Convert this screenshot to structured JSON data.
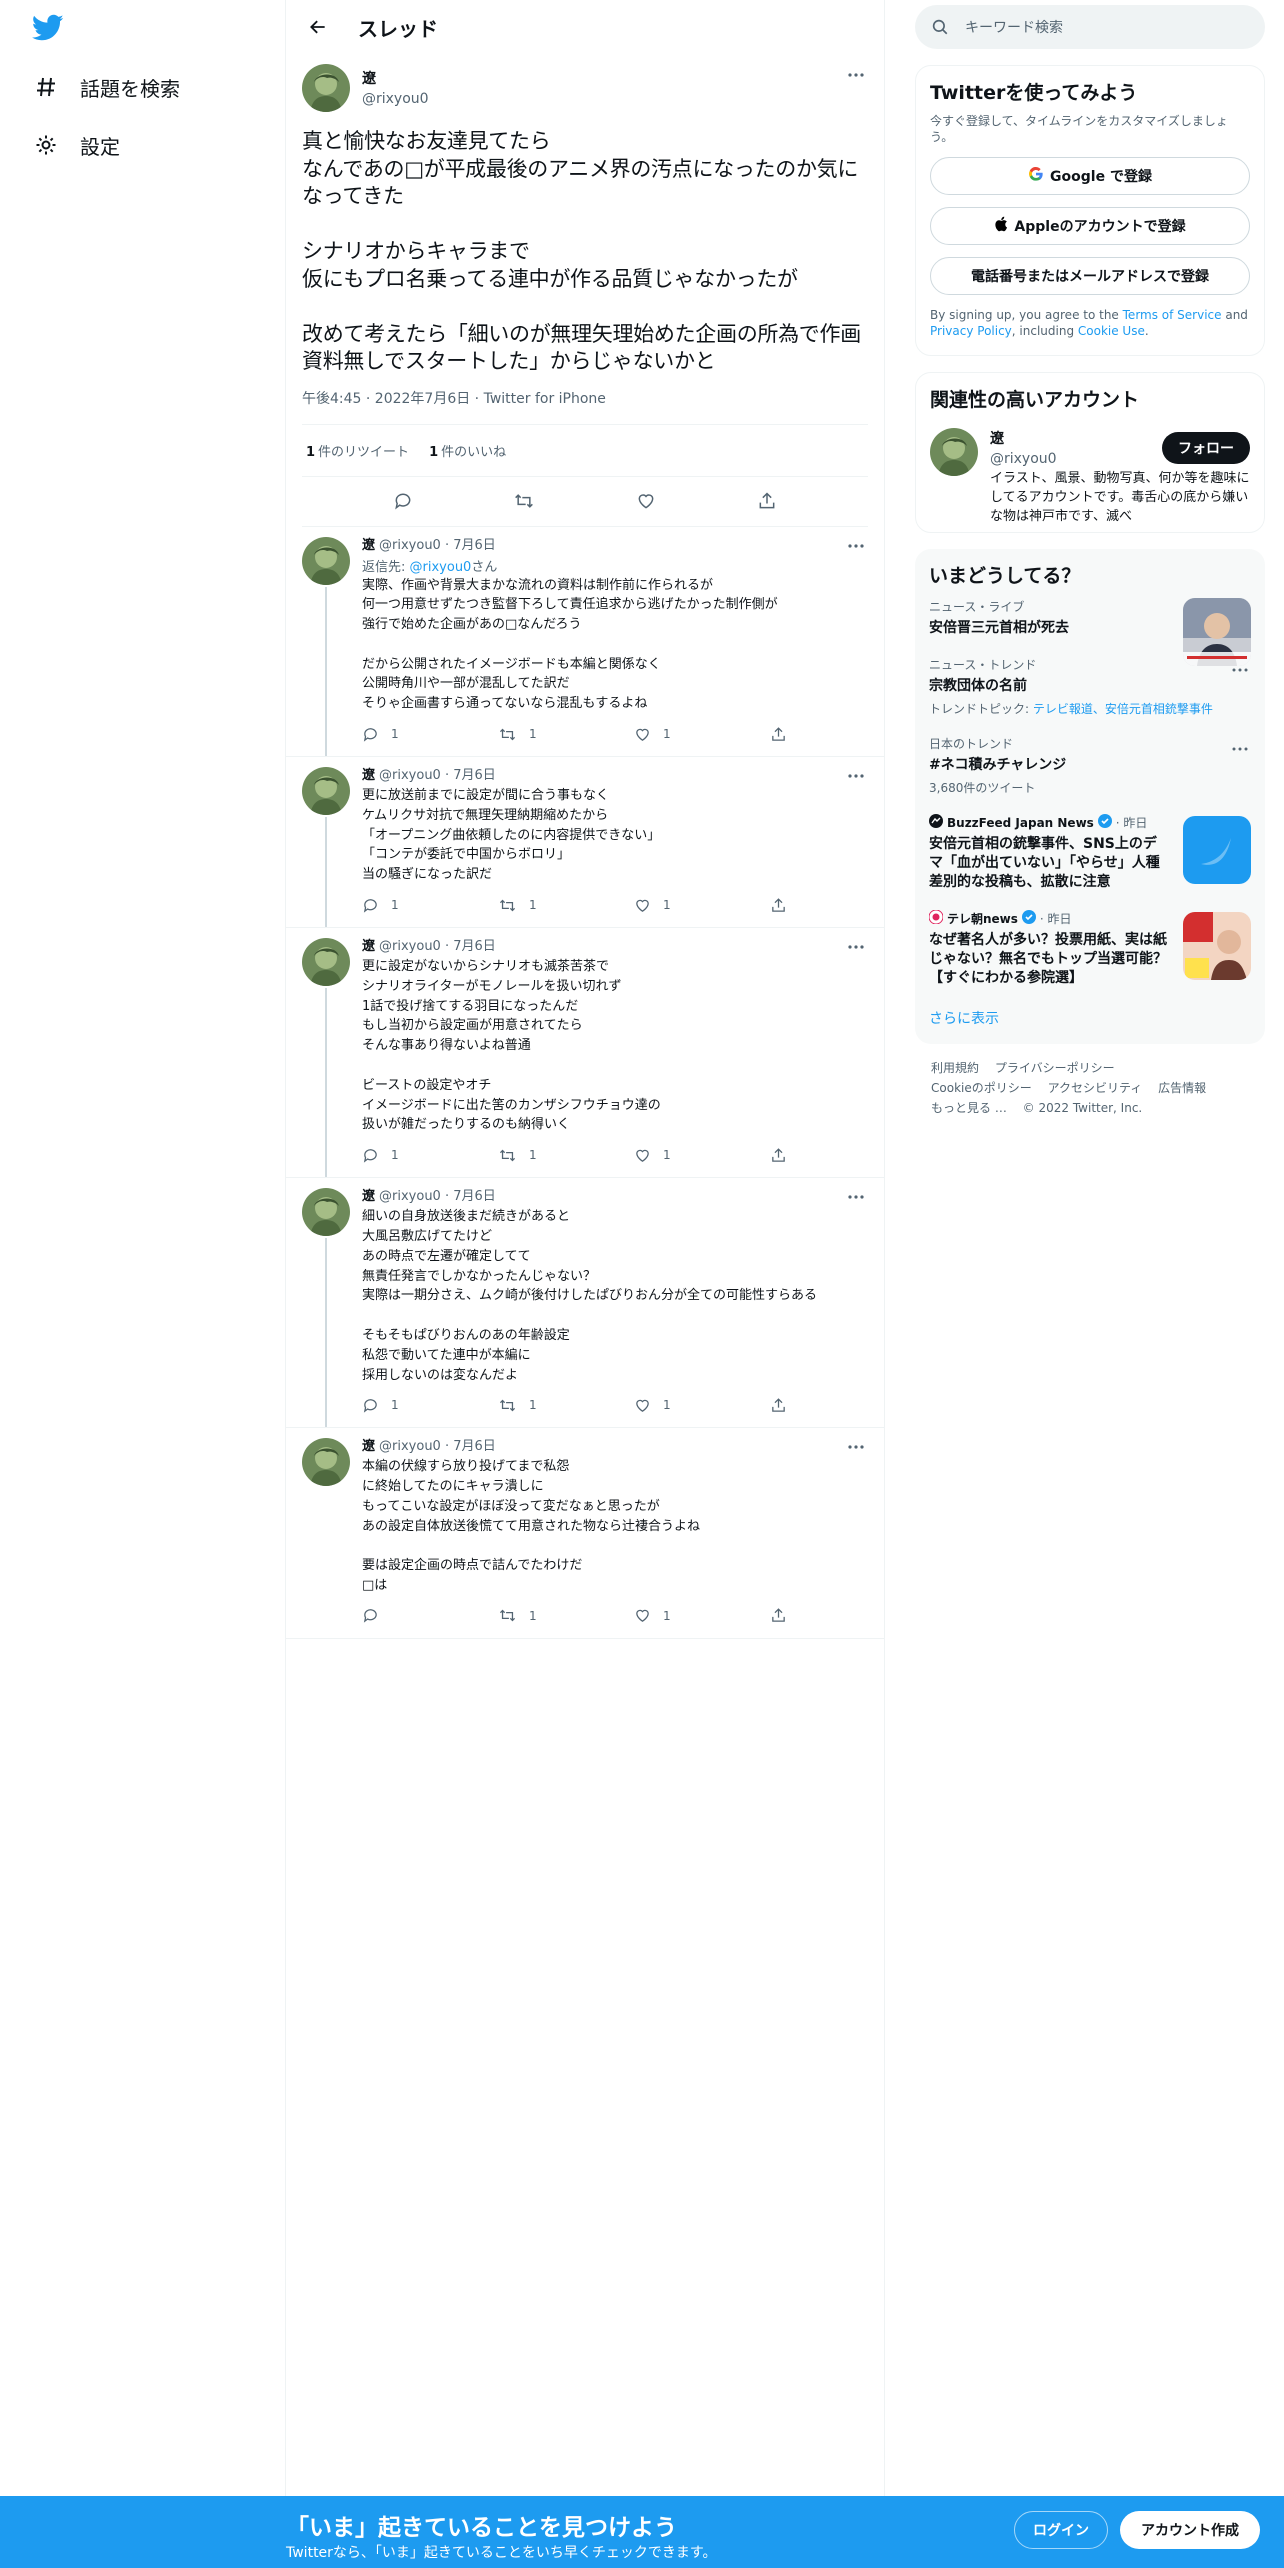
{
  "colors": {
    "accent": "#1d9bf0",
    "text": "#0f1419",
    "muted": "#536471"
  },
  "nav": {
    "logo": "twitter-bird-icon",
    "items": [
      {
        "label": "話題を検索",
        "icon": "hashtag-icon"
      },
      {
        "label": "設定",
        "icon": "gear-icon"
      }
    ]
  },
  "header": {
    "title": "スレッド"
  },
  "focal": {
    "name": "遼",
    "handle": "@rixyou0",
    "text": "真と愉快なお友達見てたら\nなんであの□が平成最後のアニメ界の汚点になったのか気になってきた\n\nシナリオからキャラまで\n仮にもプロ名乗ってる連中が作る品質じゃなかったが\n\n改めて考えたら「細いのが無理矢理始めた企画の所為で作画資料無しでスタートした」からじゃないかと",
    "meta": "午後4:45 · 2022年7月6日 · Twitter for iPhone",
    "retweets_count": "1",
    "retweets_label": "件のリツイート",
    "likes_count": "1",
    "likes_label": "件のいいね"
  },
  "replies": [
    {
      "name": "遼",
      "meta": "@rixyou0 · 7月6日",
      "replying_to_prefix": "返信先: ",
      "replying_to_handle": "@rixyou0",
      "replying_to_suffix": "さん",
      "text": "実際、作画や背景大まかな流れの資料は制作前に作られるが\n何一つ用意せずたつき監督下ろして責任追求から逃げたかった制作側が\n強行で始めた企画があの□なんだろう\n\nだから公開されたイメージボードも本編と関係なく\n公開時角川や一部が混乱してた訳だ\nそりゃ企画書すら通ってないなら混乱もするよね",
      "replies": "1",
      "retweets": "1",
      "likes": "1"
    },
    {
      "name": "遼",
      "meta": "@rixyou0 · 7月6日",
      "text": "更に放送前までに設定が間に合う事もなく\nケムリクサ対抗で無理矢理納期縮めたから\n「オープニング曲依頼したのに内容提供できない」\n「コンテが委託で中国からボロリ」\n当の騒ぎになった訳だ",
      "replies": "1",
      "retweets": "1",
      "likes": "1"
    },
    {
      "name": "遼",
      "meta": "@rixyou0 · 7月6日",
      "text": "更に設定がないからシナリオも滅茶苦茶で\nシナリオライターがモノレールを扱い切れず\n1話で投げ捨てする羽目になったんだ\nもし当初から設定画が用意されてたら\nそんな事あり得ないよね普通\n\nビーストの設定やオチ\nイメージボードに出た筈のカンザシフウチョウ達の\n扱いが雑だったりするのも納得いく",
      "replies": "1",
      "retweets": "1",
      "likes": "1"
    },
    {
      "name": "遼",
      "meta": "@rixyou0 · 7月6日",
      "text": "細いの自身放送後まだ続きがあると\n大風呂敷広げてたけど\nあの時点で左遷が確定してて\n無責任発言でしかなかったんじゃない？\n実際は一期分さえ、ムク崎が後付けしたぱびりおん分が全ての可能性すらある\n\nそもそもぱびりおんのあの年齢設定\n私怨で動いてた連中が本編に\n採用しないのは変なんだよ",
      "replies": "1",
      "retweets": "1",
      "likes": "1"
    },
    {
      "name": "遼",
      "meta": "@rixyou0 · 7月6日",
      "text": "本編の伏線すら放り投げてまで私怨\nに終始してたのにキャラ潰しに\nもってこいな設定がほぼ没って変だなぁと思ったが\nあの設定自体放送後慌てて用意された物なら辻褄合うよね\n\n要は設定企画の時点で詰んでたわけだ\n□は",
      "replies": "",
      "retweets": "1",
      "likes": "1"
    }
  ],
  "search": {
    "placeholder": "キーワード検索"
  },
  "signup": {
    "title": "Twitterを使ってみよう",
    "subtitle": "今すぐ登録して、タイムラインをカスタマイズしましょう。",
    "google": "Google で登録",
    "apple": "Appleのアカウントで登録",
    "phone": "電話番号またはメールアドレスで登録",
    "terms_pre": "By signing up, you agree to the ",
    "terms_tos": "Terms of Service",
    "terms_and": " and ",
    "terms_pp": "Privacy Policy",
    "terms_inc": ", including ",
    "terms_cookie": "Cookie Use",
    "terms_end": "."
  },
  "related": {
    "title": "関連性の高いアカウント",
    "name": "遼",
    "handle": "@rixyou0",
    "bio": "イラスト、風景、動物写真、何か等を趣味にしてるアカウントです。毒舌心の底から嫌いな物は神戸市です、滅べ",
    "follow": "フォロー"
  },
  "trends": {
    "title": "いまどうしてる？",
    "items": [
      {
        "context": "ニュース・ライブ",
        "title": "安倍晋三元首相が死去",
        "thumb": true
      },
      {
        "context": "ニュース・トレンド",
        "title": "宗教団体の名前",
        "topics_label": "トレンドトピック: ",
        "topics": "テレビ報道、安倍元首相銃撃事件"
      },
      {
        "context": "日本のトレンド",
        "title": "#ネコ積みチャレンジ",
        "count": "3,680件のツイート"
      }
    ],
    "news": [
      {
        "source": "BuzzFeed Japan News",
        "time": "· 昨日",
        "title": "安倍元首相の銃撃事件、SNS上のデマ「血が出ていない」「やらせ」人種差別的な投稿も、拡散に注意"
      },
      {
        "source": "テレ朝news",
        "time": "· 昨日",
        "title": "なぜ著名人が多い？投票用紙、実は紙じゃない？無名でもトップ当選可能？【すぐにわかる参院選】"
      }
    ],
    "show_more": "さらに表示"
  },
  "footer": {
    "links": [
      "利用規約",
      "プライバシーポリシー",
      "Cookieのポリシー",
      "アクセシビリティ",
      "広告情報",
      "もっと見る …",
      "© 2022 Twitter, Inc."
    ]
  },
  "banner": {
    "title": "「いま」起きていることを見つけよう",
    "subtitle": "Twitterなら、「いま」起きていることをいち早くチェックできます。",
    "login": "ログイン",
    "signup": "アカウント作成"
  }
}
